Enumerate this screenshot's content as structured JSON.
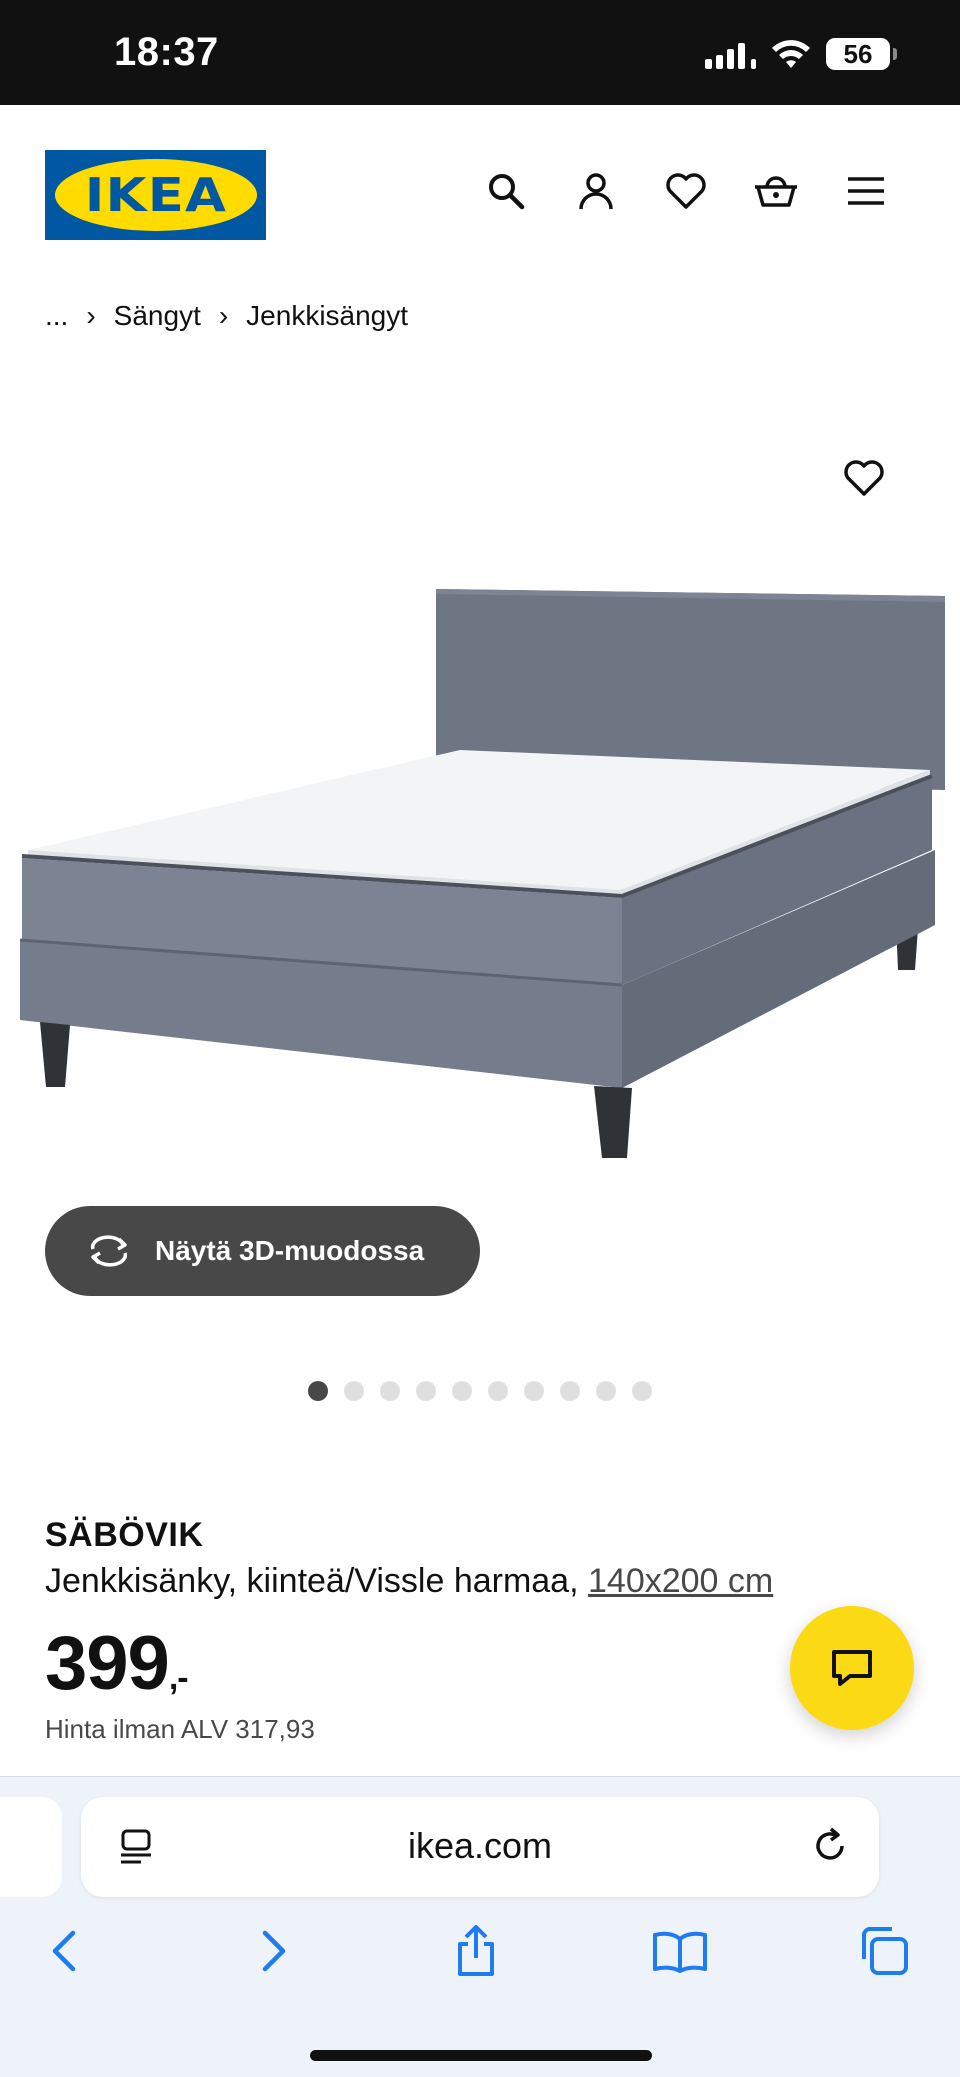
{
  "status_bar": {
    "time": "18:37",
    "battery": "56"
  },
  "header": {
    "logo_text": "IKEA",
    "icons": [
      "search-icon",
      "account-icon",
      "favorites-icon",
      "cart-icon",
      "menu-icon"
    ]
  },
  "breadcrumb": {
    "ellipsis": "...",
    "items": [
      "Sängyt",
      "Jenkkisängyt"
    ]
  },
  "gallery": {
    "view_3d_label": "Näytä 3D-muodossa",
    "dot_count": 10,
    "active_index": 0
  },
  "product": {
    "name": "SÄBÖVIK",
    "description": "Jenkkisänky, kiinteä/Vissle harmaa, ",
    "size": "140x200 cm",
    "price": "399",
    "price_suffix": ",-",
    "vat_text": "Hinta ilman ALV 317,93"
  },
  "browser": {
    "url": "ikea.com"
  },
  "colors": {
    "ikea_blue": "#0058A3",
    "ikea_yellow": "#FFDB00",
    "chat_yellow": "#FBD914",
    "dark_button": "#484848"
  }
}
